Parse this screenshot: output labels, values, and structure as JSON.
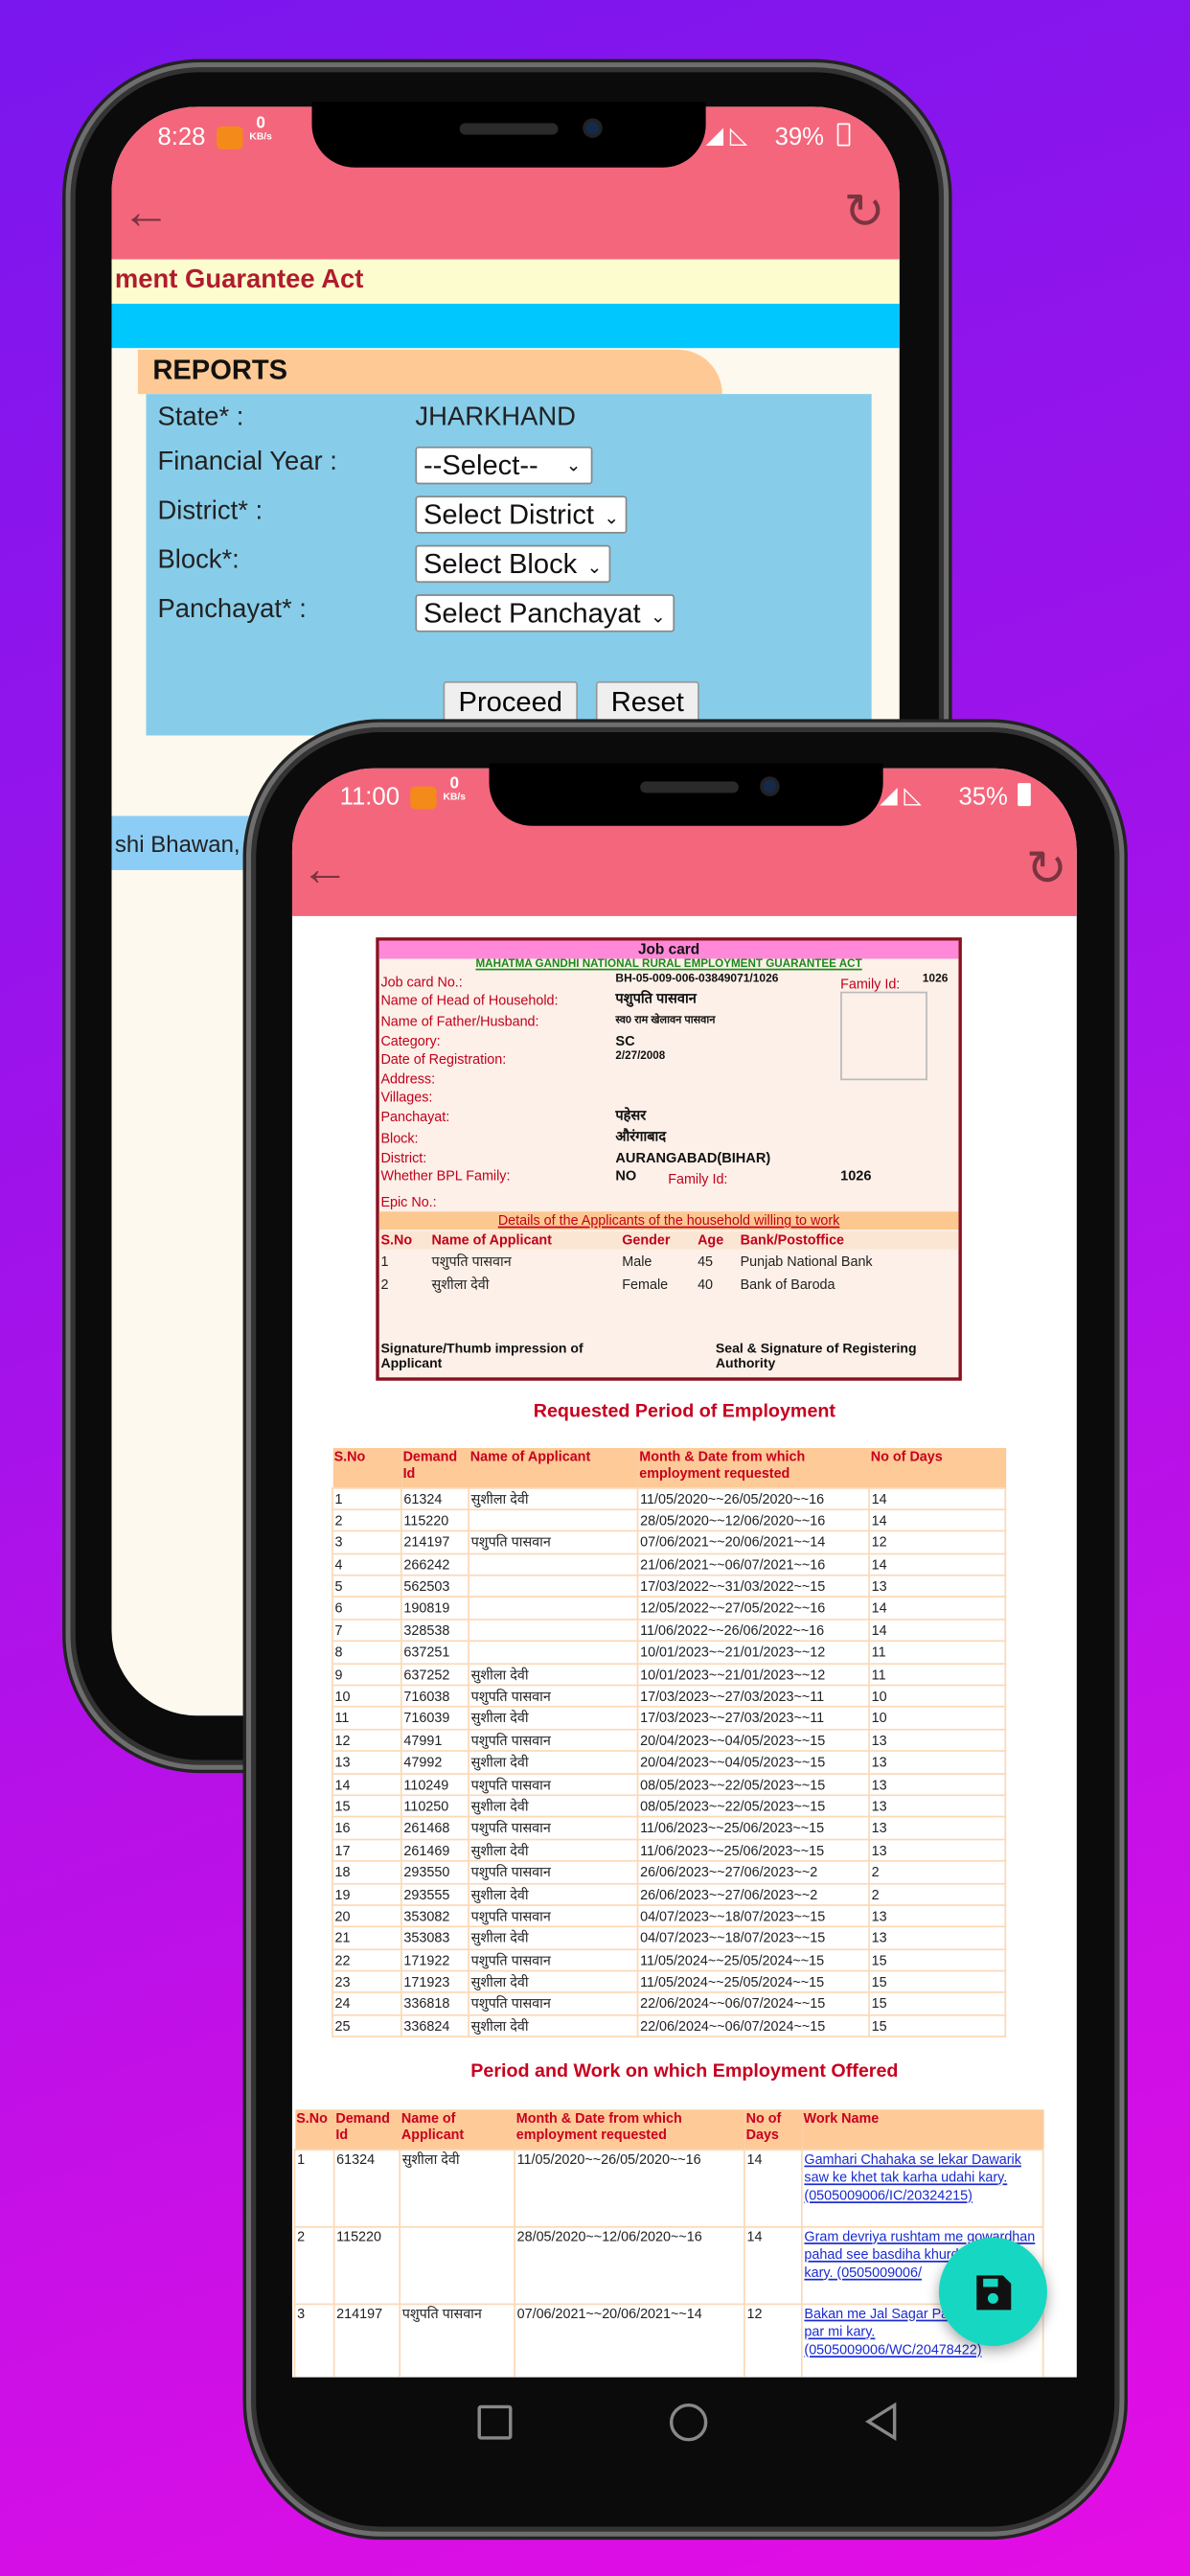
{
  "back_screen": {
    "status": {
      "time": "8:28",
      "net_speed": "0",
      "net_unit": "KB/s",
      "battery": "39%"
    },
    "banner_title": "ment Guarantee Act",
    "reports_title": "REPORTS",
    "form": {
      "state_label": "State* :",
      "state_value": "JHARKHAND",
      "fy_label": "Financial Year :",
      "fy_value": "--Select--",
      "district_label": "District* :",
      "district_value": "Select District",
      "block_label": "Block*:",
      "block_value": "Select Block",
      "panchayat_label": "Panchayat* :",
      "panchayat_value": "Select Panchayat",
      "proceed": "Proceed",
      "reset": "Reset"
    },
    "footer_text": "shi Bhawan, N"
  },
  "front_screen": {
    "status": {
      "time": "11:00",
      "net_speed": "0",
      "net_unit": "KB/s",
      "battery": "35%"
    },
    "job_card": {
      "title": "Job card",
      "subtitle": "MAHATMA GANDHI NATIONAL RURAL EMPLOYMENT GUARANTEE ACT",
      "job_card_no_label": "Job card No.:",
      "job_card_no": "BH-05-009-006-03849071/1026",
      "family_id_label": "Family Id:",
      "family_id": "1026",
      "head_label": "Name of Head of Household:",
      "head": "पशुपति पासवान",
      "father_label": "Name of Father/Husband:",
      "father": "स्व0 राम खेलावन पासवान",
      "category_label": "Category:",
      "category": "SC",
      "reg_date_label": "Date of Registration:",
      "reg_date": "2/27/2008",
      "address_label": "Address:",
      "villages_label": "Villages:",
      "panchayat_label": "Panchayat:",
      "panchayat": "पहेसर",
      "block_label": "Block:",
      "block": "औरंगाबाद",
      "district_label": "District:",
      "district": "AURANGABAD(BIHAR)",
      "bpl_label": "Whether BPL Family:",
      "bpl": "NO",
      "family_id_label2": "Family Id:",
      "family_id2": "1026",
      "epic_label": "Epic No.:",
      "applicants_heading": "Details of the Applicants of the household willing to work",
      "applicant_headers": [
        "S.No",
        "Name of Applicant",
        "Gender",
        "Age",
        "Bank/Postoffice"
      ],
      "applicants": [
        [
          "1",
          "पशुपति पासवान",
          "Male",
          "45",
          "Punjab National Bank"
        ],
        [
          "2",
          "सुशीला देवी",
          "Female",
          "40",
          "Bank of Baroda"
        ]
      ],
      "signature_applicant": "Signature/Thumb impression of Applicant",
      "signature_authority": "Seal & Signature of Registering Authority"
    },
    "requested": {
      "heading": "Requested Period of Employment",
      "headers": [
        "S.No",
        "Demand Id",
        "Name of Applicant",
        "Month & Date from which employment requested",
        "No of Days"
      ],
      "rows": [
        [
          "1",
          "61324",
          "सुशीला देवी",
          "11/05/2020~~26/05/2020~~16",
          "14"
        ],
        [
          "2",
          "115220",
          "",
          "28/05/2020~~12/06/2020~~16",
          "14"
        ],
        [
          "3",
          "214197",
          "पशुपति पासवान",
          "07/06/2021~~20/06/2021~~14",
          "12"
        ],
        [
          "4",
          "266242",
          "",
          "21/06/2021~~06/07/2021~~16",
          "14"
        ],
        [
          "5",
          "562503",
          "",
          "17/03/2022~~31/03/2022~~15",
          "13"
        ],
        [
          "6",
          "190819",
          "",
          "12/05/2022~~27/05/2022~~16",
          "14"
        ],
        [
          "7",
          "328538",
          "",
          "11/06/2022~~26/06/2022~~16",
          "14"
        ],
        [
          "8",
          "637251",
          "",
          "10/01/2023~~21/01/2023~~12",
          "11"
        ],
        [
          "9",
          "637252",
          "सुशीला देवी",
          "10/01/2023~~21/01/2023~~12",
          "11"
        ],
        [
          "10",
          "716038",
          "पशुपति पासवान",
          "17/03/2023~~27/03/2023~~11",
          "10"
        ],
        [
          "11",
          "716039",
          "सुशीला देवी",
          "17/03/2023~~27/03/2023~~11",
          "10"
        ],
        [
          "12",
          "47991",
          "पशुपति पासवान",
          "20/04/2023~~04/05/2023~~15",
          "13"
        ],
        [
          "13",
          "47992",
          "सुशीला देवी",
          "20/04/2023~~04/05/2023~~15",
          "13"
        ],
        [
          "14",
          "110249",
          "पशुपति पासवान",
          "08/05/2023~~22/05/2023~~15",
          "13"
        ],
        [
          "15",
          "110250",
          "सुशीला देवी",
          "08/05/2023~~22/05/2023~~15",
          "13"
        ],
        [
          "16",
          "261468",
          "पशुपति पासवान",
          "11/06/2023~~25/06/2023~~15",
          "13"
        ],
        [
          "17",
          "261469",
          "सुशीला देवी",
          "11/06/2023~~25/06/2023~~15",
          "13"
        ],
        [
          "18",
          "293550",
          "पशुपति पासवान",
          "26/06/2023~~27/06/2023~~2",
          "2"
        ],
        [
          "19",
          "293555",
          "सुशीला देवी",
          "26/06/2023~~27/06/2023~~2",
          "2"
        ],
        [
          "20",
          "353082",
          "पशुपति पासवान",
          "04/07/2023~~18/07/2023~~15",
          "13"
        ],
        [
          "21",
          "353083",
          "सुशीला देवी",
          "04/07/2023~~18/07/2023~~15",
          "13"
        ],
        [
          "22",
          "171922",
          "पशुपति पासवान",
          "11/05/2024~~25/05/2024~~15",
          "15"
        ],
        [
          "23",
          "171923",
          "सुशीला देवी",
          "11/05/2024~~25/05/2024~~15",
          "15"
        ],
        [
          "24",
          "336818",
          "पशुपति पासवान",
          "22/06/2024~~06/07/2024~~15",
          "15"
        ],
        [
          "25",
          "336824",
          "सुशीला देवी",
          "22/06/2024~~06/07/2024~~15",
          "15"
        ]
      ]
    },
    "offered": {
      "heading": "Period and Work on which Employment Offered",
      "headers": [
        "S.No",
        "Demand Id",
        "Name of Applicant",
        "Month & Date from which employment requested",
        "No of Days",
        "Work Name"
      ],
      "rows": [
        [
          "1",
          "61324",
          "सुशीला देवी",
          "11/05/2020~~26/05/2020~~16",
          "14",
          "Gamhari Chahaka se lekar Dawarik saw ke khet tak karha udahi kary. (0505009006/IC/20324215)"
        ],
        [
          "2",
          "115220",
          "",
          "28/05/2020~~12/06/2020~~16",
          "14",
          "Gram devriya rushtam me gowardhan pahad see basdiha khurd tak karha kary. (0505009006/"
        ],
        [
          "3",
          "214197",
          "पशुपति पासवान",
          "07/06/2021~~20/06/2021~~14",
          "12",
          "Bakan me Jal Sagar Pahad tak pind par mi kary. (0505009006/WC/20478422)"
        ]
      ]
    },
    "fab_icon": "save-icon",
    "colors": {
      "header": "#f4667c",
      "fab": "#16d8c2",
      "table_header": "#fdca98",
      "heading_red": "#c8001e"
    }
  }
}
